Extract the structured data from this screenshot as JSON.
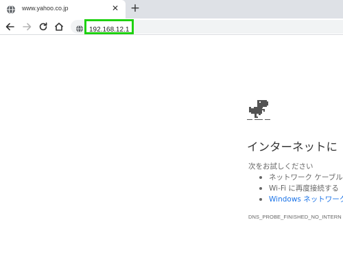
{
  "tab": {
    "title": "www.yahoo.co.jp",
    "favicon": "globe-icon",
    "close_icon": "close-icon"
  },
  "new_tab_icon": "plus-icon",
  "toolbar": {
    "back_icon": "back-arrow-icon",
    "forward_icon": "forward-arrow-icon",
    "reload_icon": "reload-icon",
    "home_icon": "home-icon",
    "site_icon": "globe-icon",
    "url": "192.168.12.1",
    "url_highlight_color": "#1ed10f"
  },
  "error_page": {
    "dino_icon": "offline-dino-icon",
    "heading": "インターネットに",
    "suggestions_label": "次をお試しください",
    "suggestions": [
      {
        "text": "ネットワーク ケーブル",
        "is_link": false
      },
      {
        "text": "Wi-Fi に再度接続する",
        "is_link": false
      },
      {
        "text": "Windows ネットワーク",
        "is_link": true
      }
    ],
    "error_code": "DNS_PROBE_FINISHED_NO_INTERN",
    "link_color": "#1a73e8"
  }
}
